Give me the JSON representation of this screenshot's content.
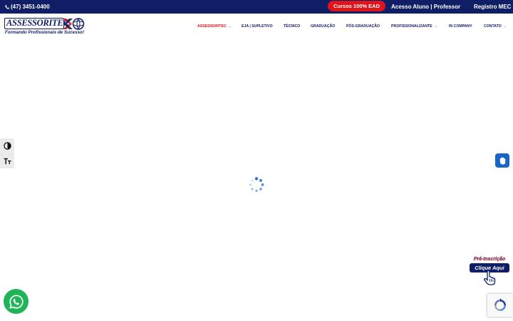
{
  "topbar": {
    "phone": "(47) 3451-0400",
    "ead_label": "Cursos 100% EAD",
    "access_label": "Acesso Aluno | Professor",
    "mec_label": "Registro MEC"
  },
  "logo": {
    "wordmark": "ASSESSORITEC",
    "slogan": "Formando Profissionais de Sucesso!"
  },
  "nav": {
    "items": [
      {
        "label": "ASSESSORITEC",
        "dropdown": true,
        "active": true
      },
      {
        "label": "EJA | SUPLETIVO",
        "dropdown": false
      },
      {
        "label": "TÉCNICO",
        "dropdown": false
      },
      {
        "label": "GRADUAÇÃO",
        "dropdown": false
      },
      {
        "label": "PÓS-GRADUAÇÃO",
        "dropdown": false
      },
      {
        "label": "PROFISSIONALIZANTE",
        "dropdown": true
      },
      {
        "label": "IN COMPANY",
        "dropdown": false
      },
      {
        "label": "CONTATO",
        "dropdown": true
      }
    ],
    "chevron": "⌄"
  },
  "preregistration": {
    "title": "Pré-Inscrição",
    "cta": "Clique Aqui"
  },
  "icons": {
    "phone": "phone-icon",
    "contrast": "contrast-icon",
    "font_size": "font-size-icon",
    "sign_language": "sign-language-icon",
    "pointer": "hand-pointer-icon",
    "whatsapp": "whatsapp-icon",
    "recaptcha": "recaptcha-icon",
    "loader": "loading-spinner-icon"
  },
  "colors": {
    "brand_navy": "#101e66",
    "accent_red": "#e0141b",
    "whatsapp_green": "#1fb457",
    "vlibras_blue": "#1a63c8"
  }
}
